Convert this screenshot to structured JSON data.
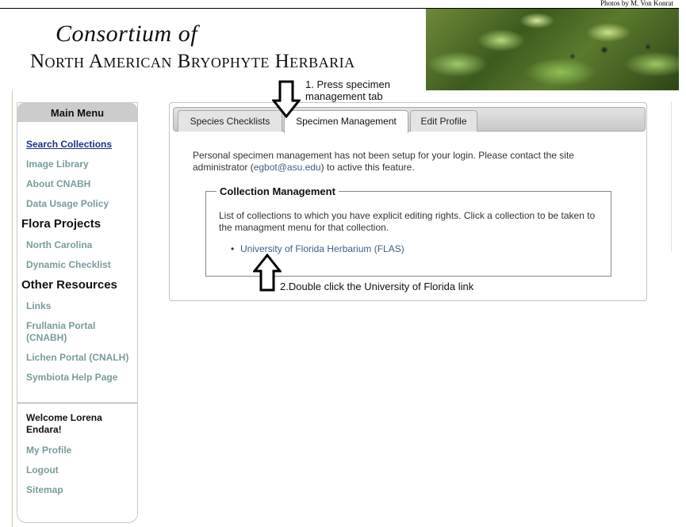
{
  "header": {
    "photo_credit": "Photos by M. Von Konrat",
    "title_line1": "Consortium of",
    "title_line2": "North American Bryophyte Herbaria"
  },
  "sidebar": {
    "header": "Main Menu",
    "items": [
      {
        "label": "Search Collections"
      },
      {
        "label": "Image Library"
      },
      {
        "label": "About CNABH"
      },
      {
        "label": "Data Usage Policy"
      },
      {
        "label": "North Carolina"
      },
      {
        "label": "Dynamic Checklist"
      },
      {
        "label": "Links"
      },
      {
        "label": "Frullania Portal (CNABH)"
      },
      {
        "label": "Lichen Portal (CNALH)"
      },
      {
        "label": "Symbiota Help Page"
      }
    ],
    "sections": {
      "flora": "Flora Projects",
      "other": "Other Resources"
    },
    "welcome": "Welcome Lorena Endara!",
    "user_links": [
      {
        "label": "My Profile"
      },
      {
        "label": "Logout"
      },
      {
        "label": "Sitemap"
      }
    ]
  },
  "tabs": [
    {
      "label": "Species Checklists"
    },
    {
      "label": "Specimen Management",
      "selected": true
    },
    {
      "label": "Edit Profile"
    }
  ],
  "main": {
    "message_before": "Personal specimen management has not been setup for your login. Please contact the site administrator (",
    "email": "egbot@asu.edu",
    "message_after": ") to active this feature.",
    "collection_legend": "Collection Management",
    "collection_desc": "List of collections to which you have explicit editing rights. Click a collection to be taken to the managment menu for that collection.",
    "collections": [
      {
        "label": "University of Florida Herbarium (FLAS)"
      }
    ]
  },
  "annotations": {
    "step1": "1. Press specimen management tab",
    "step2": "2.Double click the University of Florida link"
  },
  "colors": {
    "link_active": "#1f2f8a",
    "link": "#7a9b9b",
    "link_blue": "#3f5f86"
  }
}
